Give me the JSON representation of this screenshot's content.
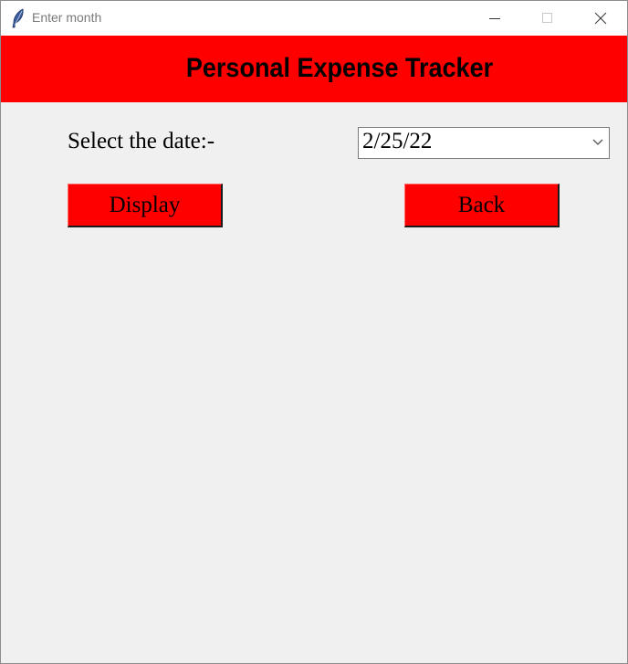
{
  "window": {
    "title": "Enter month"
  },
  "header": {
    "title": "Personal Expense Tracker",
    "color": "#ff0000"
  },
  "form": {
    "date_label": "Select the date:-",
    "date_value": "2/25/22"
  },
  "buttons": {
    "display_label": "Display",
    "back_label": "Back",
    "color": "#ff0000"
  },
  "icons": {
    "app": "feather-icon",
    "minimize": "minimize-icon",
    "maximize": "maximize-icon",
    "close": "close-icon",
    "dropdown": "chevron-down-icon"
  }
}
